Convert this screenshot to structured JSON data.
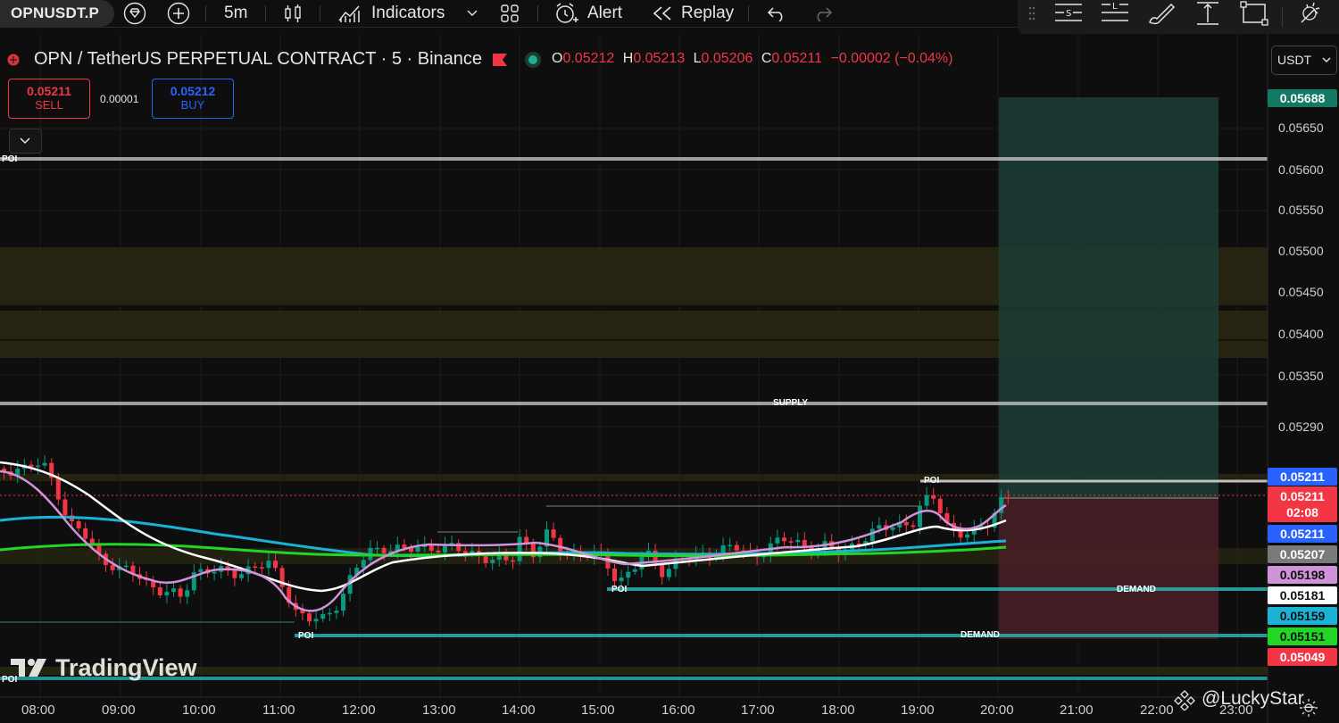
{
  "toolbar": {
    "symbol": "OPNUSDT.P",
    "interval": "5m",
    "indicators_label": "Indicators",
    "alert_label": "Alert",
    "replay_label": "Replay"
  },
  "legend": {
    "title": "OPN / TetherUS PERPETUAL CONTRACT · 5 · Binance",
    "open_key": "O",
    "open": "0.05212",
    "high_key": "H",
    "high": "0.05213",
    "low_key": "L",
    "low": "0.05206",
    "close_key": "C",
    "close": "0.05211",
    "change": "−0.00002 (−0.04%)"
  },
  "trade": {
    "sell_price": "0.05211",
    "sell_label": "SELL",
    "spread": "0.00001",
    "buy_price": "0.05212",
    "buy_label": "BUY"
  },
  "currency_button": "USDT",
  "price_axis": {
    "ticks": [
      "0.05650",
      "0.05600",
      "0.05550",
      "0.05500",
      "0.05450",
      "0.05400",
      "0.05350",
      "0.05290"
    ]
  },
  "price_labels": {
    "target": "0.05688",
    "blue_1": "0.05211",
    "current_price": "0.05211",
    "countdown": "02:08",
    "blue_2": "0.05211",
    "gray": "0.05207",
    "ma_pink": "0.05198",
    "ma_white": "0.05181",
    "ma_cyan": "0.05159",
    "ma_green": "0.05151",
    "stop": "0.05049"
  },
  "time_axis": [
    "08:00",
    "09:00",
    "10:00",
    "11:00",
    "12:00",
    "13:00",
    "14:00",
    "15:00",
    "16:00",
    "17:00",
    "18:00",
    "19:00",
    "20:00",
    "21:00",
    "22:00",
    "23:00"
  ],
  "zones": {
    "poi_top": "POI",
    "supply": "SUPPLY",
    "poi_right": "POI",
    "poi_mid": "POI",
    "demand_1": "DEMAND",
    "poi_left": "POI",
    "demand_2": "DEMAND",
    "poi_bottom": "POI"
  },
  "watermark": "TradingView",
  "credit": "@LuckyStar_",
  "colors": {
    "up": "#089981",
    "down": "#f23645",
    "ma_white": "#ffffff",
    "ma_pink": "#ce93d8",
    "ma_cyan": "#1ab3d6",
    "ma_green": "#22d626",
    "target_zone": "#1b3d36",
    "stop_zone": "#4a1e27"
  }
}
